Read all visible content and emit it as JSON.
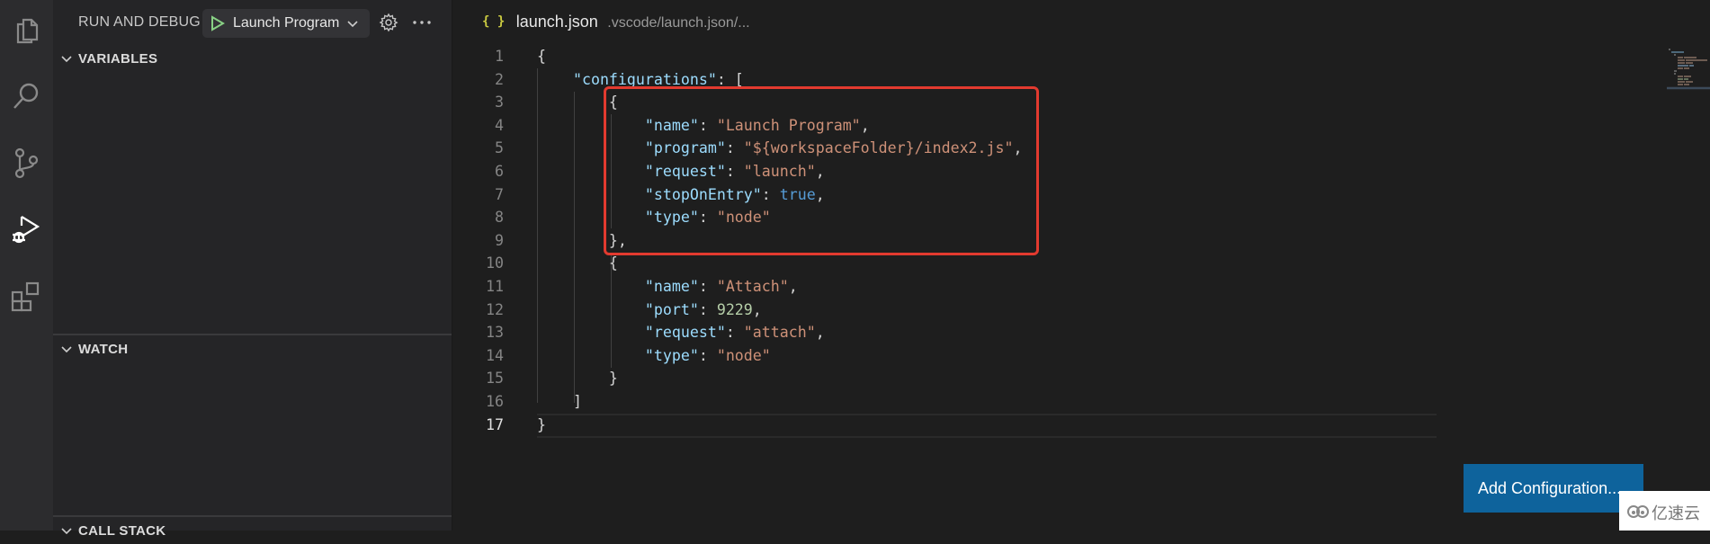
{
  "activity_bar": {
    "items": [
      {
        "name": "explorer",
        "icon": "files-icon",
        "active": false
      },
      {
        "name": "search",
        "icon": "search-icon",
        "active": false
      },
      {
        "name": "source-control",
        "icon": "source-control-icon",
        "active": false
      },
      {
        "name": "run-and-debug",
        "icon": "run-debug-icon",
        "active": true
      },
      {
        "name": "extensions",
        "icon": "extensions-icon",
        "active": false
      }
    ]
  },
  "sidebar": {
    "title": "RUN AND DEBUG",
    "debug_config": {
      "selected": "Launch Program",
      "icon": "play-icon"
    },
    "actions": [
      {
        "icon": "gear-icon",
        "label": "Open launch.json"
      },
      {
        "icon": "more-icon",
        "label": "More actions"
      }
    ],
    "sections": [
      {
        "label": "VARIABLES",
        "expanded": true
      },
      {
        "label": "WATCH",
        "expanded": true
      },
      {
        "label": "CALL STACK",
        "expanded": true
      }
    ]
  },
  "editor": {
    "breadcrumb": {
      "icon": "json-braces-icon",
      "icon_text": "{ }",
      "filename": "launch.json",
      "path": ".vscode/launch.json/..."
    },
    "current_line": 17,
    "lines": [
      {
        "n": "1",
        "code": "{"
      },
      {
        "n": "2",
        "code": "    \"configurations\": ["
      },
      {
        "n": "3",
        "code": "        {"
      },
      {
        "n": "4",
        "code": "            \"name\": \"Launch Program\","
      },
      {
        "n": "5",
        "code": "            \"program\": \"${workspaceFolder}/index2.js\","
      },
      {
        "n": "6",
        "code": "            \"request\": \"launch\","
      },
      {
        "n": "7",
        "code": "            \"stopOnEntry\": true,"
      },
      {
        "n": "8",
        "code": "            \"type\": \"node\""
      },
      {
        "n": "9",
        "code": "        },"
      },
      {
        "n": "10",
        "code": "        {"
      },
      {
        "n": "11",
        "code": "            \"name\": \"Attach\","
      },
      {
        "n": "12",
        "code": "            \"port\": 9229,"
      },
      {
        "n": "13",
        "code": "            \"request\": \"attach\","
      },
      {
        "n": "14",
        "code": "            \"type\": \"node\""
      },
      {
        "n": "15",
        "code": "        }"
      },
      {
        "n": "16",
        "code": "    ]"
      },
      {
        "n": "17",
        "code": "}"
      }
    ],
    "annotation": {
      "type": "highlight-box",
      "color": "#e23a2f",
      "lines": [
        3,
        9
      ]
    },
    "add_configuration_label": "Add Configuration..."
  },
  "watermark": {
    "text": "亿速云"
  },
  "colors": {
    "accent_button": "#0e639c",
    "annotation_red": "#e23a2f",
    "json_key": "#9cdcfe",
    "json_string": "#ce9178",
    "json_number": "#b5cea8",
    "json_boolean": "#569cd6",
    "play_green": "#89d185"
  }
}
